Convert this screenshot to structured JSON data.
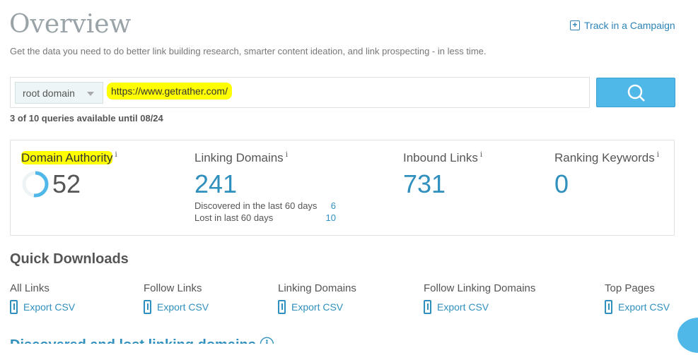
{
  "header": {
    "title": "Overview",
    "subtitle": "Get the data you need to do better link building research, smarter content ideation, and link prospecting - in less time.",
    "track_label": "Track in a Campaign"
  },
  "search": {
    "scope": "root domain",
    "url": "https://www.getrather.com/",
    "quota": "3 of 10 queries available until 08/24"
  },
  "stats": {
    "domain_authority": {
      "label": "Domain Authority",
      "value": "52",
      "gauge_fraction": 0.52
    },
    "linking_domains": {
      "label": "Linking Domains",
      "value": "241",
      "discovered_label": "Discovered in the last 60 days",
      "discovered": "6",
      "lost_label": "Lost in last 60 days",
      "lost": "10"
    },
    "inbound_links": {
      "label": "Inbound Links",
      "value": "731"
    },
    "ranking_keywords": {
      "label": "Ranking Keywords",
      "value": "0"
    },
    "info": "i"
  },
  "downloads": {
    "title": "Quick Downloads",
    "export_label": "Export CSV",
    "items": [
      "All Links",
      "Follow Links",
      "Linking Domains",
      "Follow Linking Domains",
      "Top Pages"
    ]
  },
  "next_section": "Discovered and lost linking domains ⓘ"
}
